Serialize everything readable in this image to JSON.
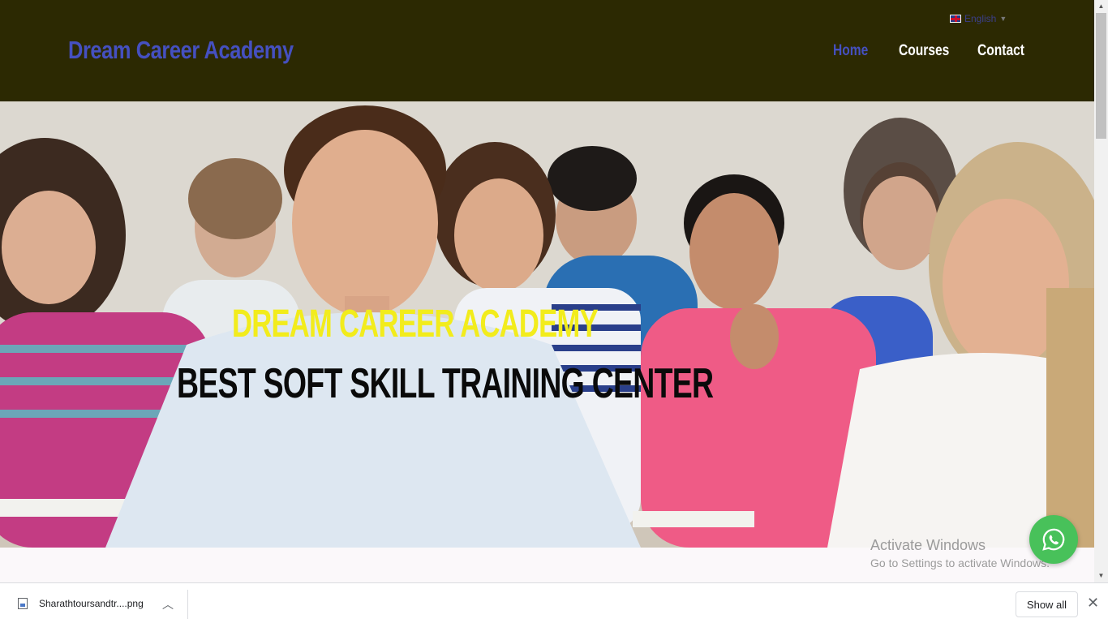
{
  "header": {
    "brand": "Dream Career Academy",
    "language": "English",
    "nav": [
      {
        "label": "Home",
        "active": true
      },
      {
        "label": "Courses",
        "active": false
      },
      {
        "label": "Contact",
        "active": false
      }
    ]
  },
  "hero": {
    "title": "DREAM CAREER ACADEMY",
    "subtitle": "BEST SOFT SKILL TRAINING CENTER"
  },
  "watermark": {
    "line1": "Activate Windows",
    "line2": "Go to Settings to activate Windows."
  },
  "downloads": {
    "file_name": "Sharathtoursandtr....png",
    "show_all": "Show all"
  },
  "colors": {
    "header_bg": "#2c2902",
    "brand": "#4550c0",
    "hero_title": "#f2ec1c",
    "whatsapp": "#48c15a"
  },
  "icons": [
    "uk-flag-icon",
    "whatsapp-icon",
    "file-icon",
    "chevron-up-icon",
    "close-icon"
  ]
}
